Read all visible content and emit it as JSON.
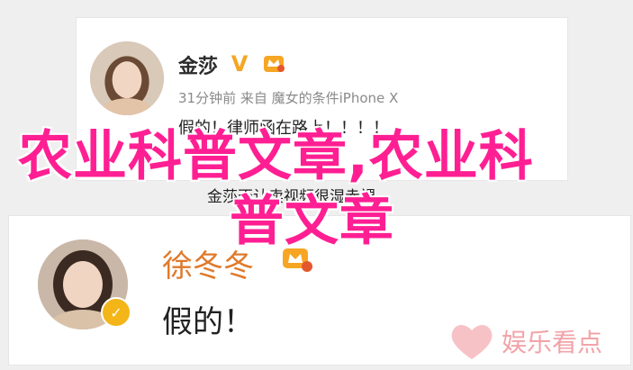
{
  "posts": [
    {
      "username": "金莎",
      "verified_mark": "V",
      "timestamp_source": "31分钟前 来自 魔女的条件iPhone X",
      "text": "假的！律师函在路上！！！！"
    },
    {
      "username": "徐冬冬",
      "text": "假的！"
    }
  ],
  "caption": "金莎否认卖视频很湿赤裸",
  "overlay": {
    "line1": "农业科普文章,农业科",
    "line2": "普文章"
  },
  "watermark": {
    "text": "娱乐看点"
  },
  "colors": {
    "overlay": "#ff1f93",
    "vip": "#f6a623",
    "watermark": "#f2a3a8"
  }
}
